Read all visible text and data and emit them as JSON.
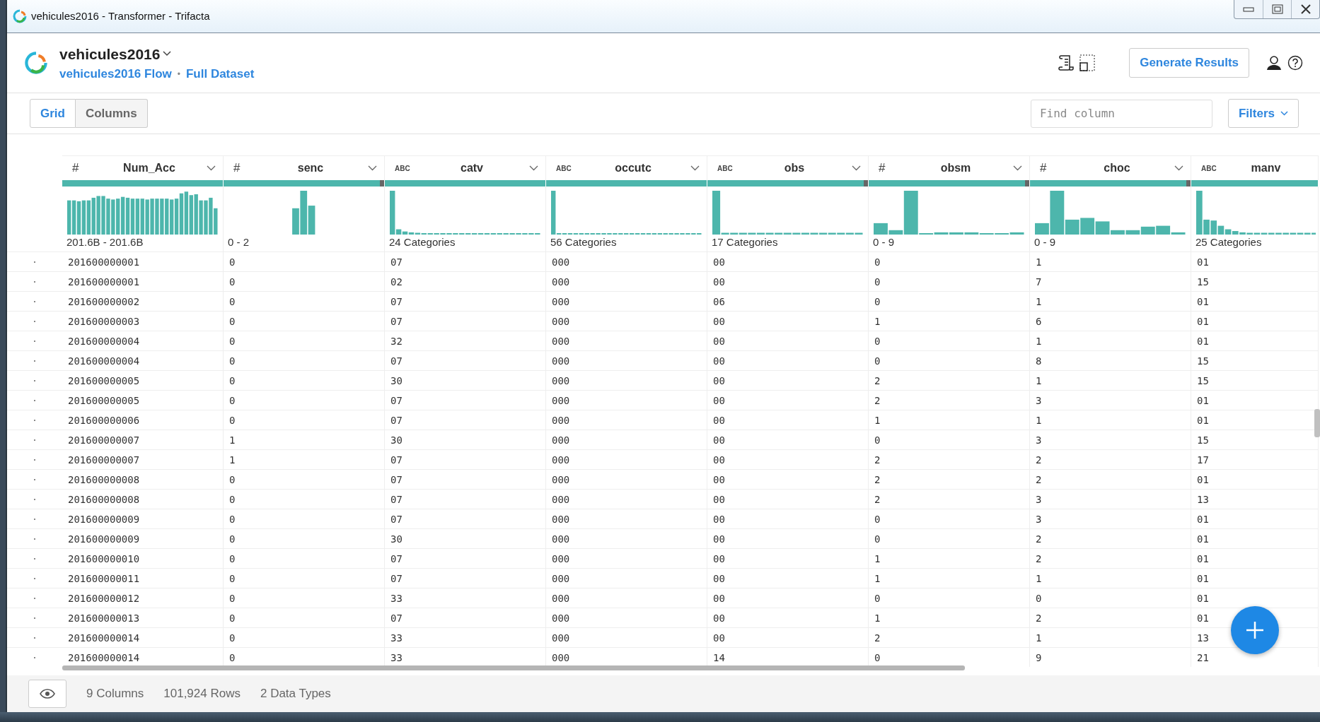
{
  "window": {
    "title": "vehicules2016 - Transformer - Trifacta"
  },
  "header": {
    "dataset": "vehicules2016",
    "flow_link": "vehicules2016 Flow",
    "separator": "•",
    "sample_link": "Full Dataset",
    "primary_button": "Generate Results"
  },
  "view_toggle": [
    {
      "label": "Grid",
      "selected": true
    },
    {
      "label": "Columns",
      "selected": false
    }
  ],
  "search": {
    "placeholder": "Find column"
  },
  "filters_button": "Filters",
  "columns": [
    {
      "kind": "number",
      "type_label": "#",
      "name": "Num_Acc",
      "summary": "201.6B - 201.6B",
      "has_missing": false
    },
    {
      "kind": "number",
      "type_label": "#",
      "name": "senc",
      "summary": "0 - 2",
      "has_missing": true
    },
    {
      "kind": "string",
      "type_label": "ABC",
      "name": "catv",
      "summary": "24 Categories",
      "has_missing": false
    },
    {
      "kind": "string",
      "type_label": "ABC",
      "name": "occutc",
      "summary": "56 Categories",
      "has_missing": false
    },
    {
      "kind": "string",
      "type_label": "ABC",
      "name": "obs",
      "summary": "17 Categories",
      "has_missing": true
    },
    {
      "kind": "number",
      "type_label": "#",
      "name": "obsm",
      "summary": "0 - 9",
      "has_missing": true
    },
    {
      "kind": "number",
      "type_label": "#",
      "name": "choc",
      "summary": "0 - 9",
      "has_missing": true
    },
    {
      "kind": "string",
      "type_label": "ABC",
      "name": "manv",
      "summary": "25 Categories",
      "has_missing": false
    }
  ],
  "rows": [
    [
      "201600000001",
      "0",
      "07",
      "000",
      "00",
      "0",
      "1",
      "01"
    ],
    [
      "201600000001",
      "0",
      "02",
      "000",
      "00",
      "0",
      "7",
      "15"
    ],
    [
      "201600000002",
      "0",
      "07",
      "000",
      "06",
      "0",
      "1",
      "01"
    ],
    [
      "201600000003",
      "0",
      "07",
      "000",
      "00",
      "1",
      "6",
      "01"
    ],
    [
      "201600000004",
      "0",
      "32",
      "000",
      "00",
      "0",
      "1",
      "01"
    ],
    [
      "201600000004",
      "0",
      "07",
      "000",
      "00",
      "0",
      "8",
      "15"
    ],
    [
      "201600000005",
      "0",
      "30",
      "000",
      "00",
      "2",
      "1",
      "15"
    ],
    [
      "201600000005",
      "0",
      "07",
      "000",
      "00",
      "2",
      "3",
      "01"
    ],
    [
      "201600000006",
      "0",
      "07",
      "000",
      "00",
      "1",
      "1",
      "01"
    ],
    [
      "201600000007",
      "1",
      "30",
      "000",
      "00",
      "0",
      "3",
      "15"
    ],
    [
      "201600000007",
      "1",
      "07",
      "000",
      "00",
      "2",
      "2",
      "17"
    ],
    [
      "201600000008",
      "0",
      "07",
      "000",
      "00",
      "2",
      "2",
      "01"
    ],
    [
      "201600000008",
      "0",
      "07",
      "000",
      "00",
      "2",
      "3",
      "13"
    ],
    [
      "201600000009",
      "0",
      "07",
      "000",
      "00",
      "0",
      "3",
      "01"
    ],
    [
      "201600000009",
      "0",
      "30",
      "000",
      "00",
      "0",
      "2",
      "01"
    ],
    [
      "201600000010",
      "0",
      "07",
      "000",
      "00",
      "1",
      "2",
      "01"
    ],
    [
      "201600000011",
      "0",
      "07",
      "000",
      "00",
      "1",
      "1",
      "01"
    ],
    [
      "201600000012",
      "0",
      "33",
      "000",
      "00",
      "0",
      "0",
      "01"
    ],
    [
      "201600000013",
      "0",
      "07",
      "000",
      "00",
      "1",
      "2",
      "01"
    ],
    [
      "201600000014",
      "0",
      "33",
      "000",
      "00",
      "2",
      "1",
      "13"
    ],
    [
      "201600000014",
      "0",
      "33",
      "000",
      "14",
      "0",
      "9",
      "21"
    ]
  ],
  "status_bar": {
    "columns": "9 Columns",
    "rows": "101,924 Rows",
    "types": "2 Data Types"
  }
}
